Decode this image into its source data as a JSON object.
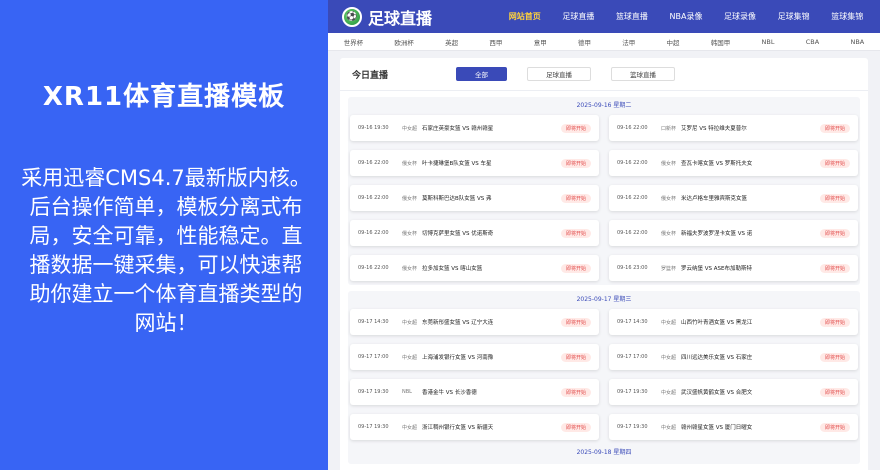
{
  "promo": {
    "title": "XR11体育直播模板",
    "body": "采用迅睿CMS4.7最新版内核。后台操作简单，模板分离式布局，安全可靠，性能稳定。直播数据一键采集，可以快速帮助你建立一个体育直播类型的网站！"
  },
  "header": {
    "logo_text": "足球直播",
    "nav": [
      "网站首页",
      "足球直播",
      "篮球直播",
      "NBA录像",
      "足球录像",
      "足球集锦",
      "篮球集锦"
    ]
  },
  "subnav": [
    "世界杯",
    "欧洲杯",
    "英超",
    "西甲",
    "意甲",
    "德甲",
    "法甲",
    "中超",
    "韩国甲",
    "NBL",
    "CBA",
    "NBA"
  ],
  "main": {
    "title": "今日直播",
    "tabs": [
      "全部",
      "足球直播",
      "篮球直播"
    ]
  },
  "days": [
    {
      "date": "2025-09-16 星期二",
      "matches": [
        {
          "time": "09-16 19:30",
          "league": "中女超",
          "match": "石家庄英豪女篮 VS 赣州赣星",
          "status": "即将开始"
        },
        {
          "time": "09-16 22:00",
          "league": "口新杯",
          "match": "艾罗尼 VS 特拉维夫夏普尔",
          "status": "即将开始"
        },
        {
          "time": "09-16 22:00",
          "league": "俄女杯",
          "match": "叶卡捷琳堡B队女篮 VS 车星",
          "status": "即将开始"
        },
        {
          "time": "09-16 22:00",
          "league": "俄女杯",
          "match": "查瓦卡喀女篮 VS 罗斯托夫女",
          "status": "即将开始"
        },
        {
          "time": "09-16 22:00",
          "league": "俄女杯",
          "match": "莫斯科斯巴达B队女篮 VS 弗",
          "status": "即将开始"
        },
        {
          "time": "09-16 22:00",
          "league": "俄女杯",
          "match": "米达卢格车里雅宾斯克女篮",
          "status": "即将开始"
        },
        {
          "time": "09-16 22:00",
          "league": "俄女杯",
          "match": "切博克萨里女篮 VS 优诺斯奇",
          "status": "即将开始"
        },
        {
          "time": "09-16 22:00",
          "league": "俄女杯",
          "match": "新福夫罗波罗涅卡女篮 VS 诺",
          "status": "即将开始"
        },
        {
          "time": "09-16 22:00",
          "league": "俄女杯",
          "match": "拉多加女篮 VS 喀山女篮",
          "status": "即将开始"
        },
        {
          "time": "09-16 23:00",
          "league": "罗篮杯",
          "match": "罗云纳堡 VS ASE布加勒斯特",
          "status": "即将开始"
        }
      ]
    },
    {
      "date": "2025-09-17 星期三",
      "matches": [
        {
          "time": "09-17 14:30",
          "league": "中女超",
          "match": "东莞新彤盛女篮 VS 辽宁大连",
          "status": "即将开始"
        },
        {
          "time": "09-17 14:30",
          "league": "中女超",
          "match": "山西竹叶青酒女篮 VS 黑龙江",
          "status": "即将开始"
        },
        {
          "time": "09-17 17:00",
          "league": "中女超",
          "match": "上海浦发银行女篮 VS 河南豫",
          "status": "即将开始"
        },
        {
          "time": "09-17 17:00",
          "league": "中女超",
          "match": "四川远达美乐女篮 VS 石家庄",
          "status": "即将开始"
        },
        {
          "time": "09-17 19:30",
          "league": "NBL",
          "match": "香港金牛 VS 长沙香德",
          "status": "即将开始"
        },
        {
          "time": "09-17 19:30",
          "league": "中女超",
          "match": "武汉盛帆黄鹤女篮 VS 合肥文",
          "status": "即将开始"
        },
        {
          "time": "09-17 19:30",
          "league": "中女超",
          "match": "浙江稠州银行女篮 VS 新疆天",
          "status": "即将开始"
        },
        {
          "time": "09-17 19:30",
          "league": "中女超",
          "match": "赣州赣星女篮 VS 厦门日曜女",
          "status": "即将开始"
        }
      ]
    }
  ],
  "next_date": "2025-09-18 星期四"
}
